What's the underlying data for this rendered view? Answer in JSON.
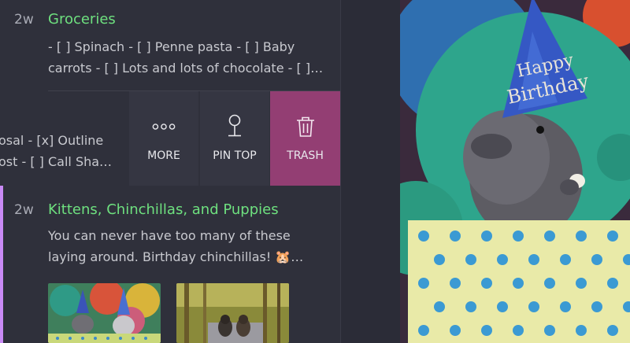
{
  "notes": [
    {
      "time": "2w",
      "title": "Groceries",
      "body_lines": [
        "- [ ] Spinach - [ ] Penne pasta - [ ] Baby",
        "carrots - [ ] Lots and lots of chocolate - [ ]…"
      ]
    },
    {
      "time": "2w",
      "title": "Kittens, Chinchillas, and Puppies",
      "body_lines": [
        "You can never have too many of these",
        "laying around. Birthday chinchillas! 🐹…"
      ]
    }
  ],
  "swiped_note": {
    "lines": [
      "osal - [x] Outline",
      "ost - [ ] Call Sha…"
    ]
  },
  "actions": {
    "more": "MORE",
    "pin_top": "PIN TOP",
    "trash": "TRASH"
  },
  "photo": {
    "hat_text_line1": "Happy",
    "hat_text_line2": "Birthday"
  },
  "colors": {
    "title_green": "#6ee07f",
    "trash_bg": "#933e73",
    "accent_bar": "#c98af5"
  }
}
